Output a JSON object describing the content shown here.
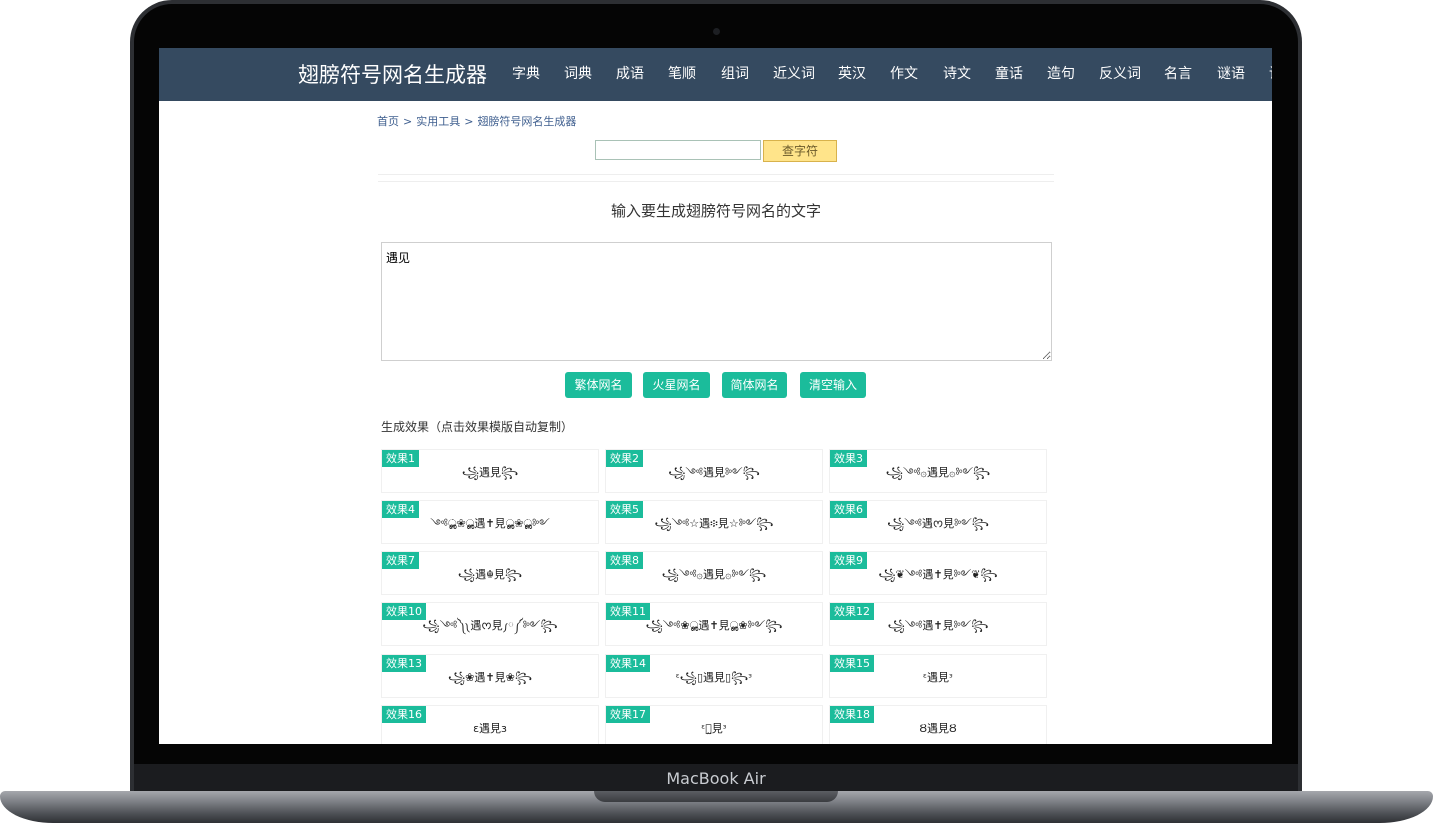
{
  "device": {
    "brand_label": "MacBook Air"
  },
  "header": {
    "site_title": "翅膀符号网名生成器",
    "nav": [
      "字典",
      "词典",
      "成语",
      "笔顺",
      "组词",
      "近义词",
      "英汉",
      "作文",
      "诗文",
      "童话",
      "造句",
      "反义词",
      "名言",
      "谜语",
      "诗"
    ]
  },
  "breadcrumb": {
    "home": "首页",
    "sep1": ">",
    "tools": "实用工具",
    "sep2": ">",
    "current": "翅膀符号网名生成器"
  },
  "search": {
    "input_value": "",
    "button_label": "查字符"
  },
  "main": {
    "heading": "输入要生成翅膀符号网名的文字",
    "input_text": "遇见",
    "buttons": {
      "traditional": "繁体网名",
      "martian": "火星网名",
      "simplified": "简体网名",
      "clear": "清空输入"
    },
    "results_label": "生成效果（点击效果模版自动复制）",
    "results": [
      {
        "tag": "效果1",
        "text": "꧁遇見꧂"
      },
      {
        "tag": "效果2",
        "text": "꧁༺遇見༻꧂"
      },
      {
        "tag": "效果3",
        "text": "꧁༺۞遇見۞༻꧂"
      },
      {
        "tag": "效果4",
        "text": "༺ൢ❀ൢ遇✝見ൢ❀ൢ༻"
      },
      {
        "tag": "效果5",
        "text": "꧁༺☆遇፨見☆༻꧂"
      },
      {
        "tag": "效果6",
        "text": "꧁༺遇ᰔ見༻꧂"
      },
      {
        "tag": "效果7",
        "text": "꧁遇☬見꧂"
      },
      {
        "tag": "效果8",
        "text": "꧁༺۞遇見۞༻꧂"
      },
      {
        "tag": "效果9",
        "text": "꧁❦༺遇✝見༻❦꧂"
      },
      {
        "tag": "效果10",
        "text": "꧁༺༽༾遇ᰔ見༿༼༻꧂"
      },
      {
        "tag": "效果11",
        "text": "꧁༺❀ൢ遇✝見ൢ❀༻꧂"
      },
      {
        "tag": "效果12",
        "text": "꧁༺遇✝見༻꧂"
      },
      {
        "tag": "效果13",
        "text": "꧁❀遇✝見❀꧂"
      },
      {
        "tag": "效果14",
        "text": "ᵋ꧁▯遇見▯꧂ᵌ"
      },
      {
        "tag": "效果15",
        "text": "ᵋ遇見ᵌ"
      },
      {
        "tag": "效果16",
        "text": "ε遇見з"
      },
      {
        "tag": "效果17",
        "text": "ᵋ遇̰見ᵌ"
      },
      {
        "tag": "效果18",
        "text": "Ȣ遇見Ȣ"
      }
    ]
  }
}
